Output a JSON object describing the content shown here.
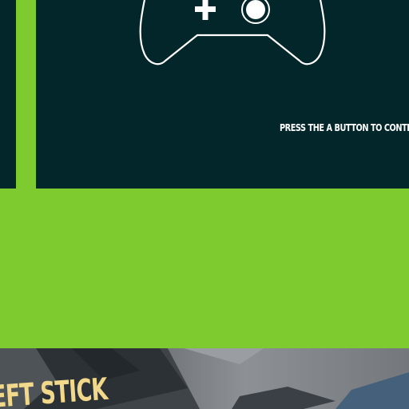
{
  "tutorial": {
    "prompt": "PRESS THE A BUTTON TO CONTINUE",
    "stick_label": "LEFT STICK"
  },
  "icons": {
    "controller": "gamepad-icon"
  },
  "colors": {
    "panel": "#03262a",
    "accent": "#7ecb2f",
    "label": "#f1d88a",
    "stroke": "#ffffff"
  }
}
